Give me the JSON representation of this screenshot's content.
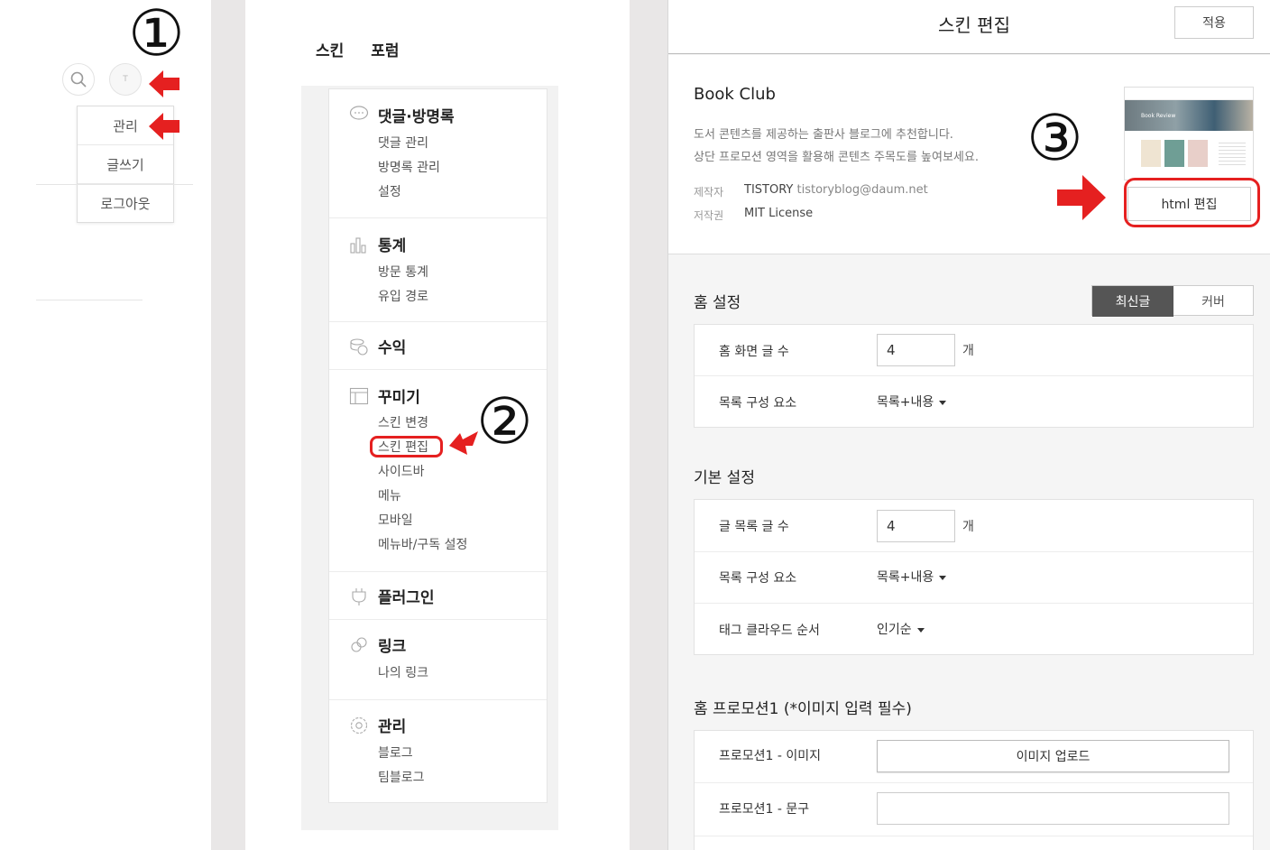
{
  "step_marks": [
    "①",
    "②",
    "③"
  ],
  "panel1": {
    "menu_items": [
      "관리",
      "글쓰기",
      "로그아웃"
    ],
    "avatar_letter": "T"
  },
  "panel2": {
    "tabs": [
      "스킨",
      "포럼"
    ],
    "sections": [
      {
        "title": "댓글·방명록",
        "icon": "comment-icon",
        "items": [
          "댓글 관리",
          "방명록 관리",
          "설정"
        ]
      },
      {
        "title": "통계",
        "icon": "bar-chart-icon",
        "items": [
          "방문 통계",
          "유입 경로"
        ]
      },
      {
        "title": "수익",
        "icon": "coins-icon",
        "items": []
      },
      {
        "title": "꾸미기",
        "icon": "layout-icon",
        "items": [
          "스킨 변경",
          "스킨 편집",
          "사이드바",
          "메뉴",
          "모바일",
          "메뉴바/구독 설정"
        ]
      },
      {
        "title": "플러그인",
        "icon": "plug-icon",
        "items": []
      },
      {
        "title": "링크",
        "icon": "link-icon",
        "items": [
          "나의 링크"
        ]
      },
      {
        "title": "관리",
        "icon": "gear-icon",
        "items": [
          "블로그",
          "팀블로그"
        ]
      }
    ]
  },
  "panel3": {
    "title": "스킨 편집",
    "apply_label": "적용",
    "skin": {
      "name": "Book Club",
      "desc1": "도서 콘텐츠를 제공하는 출판사 블로그에 추천합니다.",
      "desc2": "상단 프로모션 영역을 활용해 콘텐츠 주목도를 높여보세요.",
      "maker_label": "제작자",
      "maker_name": "TISTORY",
      "maker_email": "tistoryblog@daum.net",
      "copyright_label": "저작권",
      "license": "MIT License",
      "thumb_banner": "Book Review",
      "html_edit_label": "html 편집"
    },
    "home": {
      "title": "홈 설정",
      "toggle": [
        "최신글",
        "커버"
      ],
      "rows": [
        {
          "label": "홈 화면 글 수",
          "value": "4",
          "unit": "개"
        },
        {
          "label": "목록 구성 요소",
          "value": "목록+내용"
        }
      ]
    },
    "basic": {
      "title": "기본 설정",
      "rows": [
        {
          "label": "글 목록 글 수",
          "value": "4",
          "unit": "개"
        },
        {
          "label": "목록 구성 요소",
          "value": "목록+내용"
        },
        {
          "label": "태그 클라우드 순서",
          "value": "인기순"
        }
      ]
    },
    "promo": {
      "title": "홈 프로모션1 (*이미지 입력 필수)",
      "rows": [
        {
          "label": "프로모션1 - 이미지",
          "button": "이미지 업로드"
        },
        {
          "label": "프로모션1 - 문구",
          "value": ""
        }
      ]
    }
  },
  "colors": {
    "accent_red": "#e52020",
    "toggle_active_bg": "#555555"
  }
}
